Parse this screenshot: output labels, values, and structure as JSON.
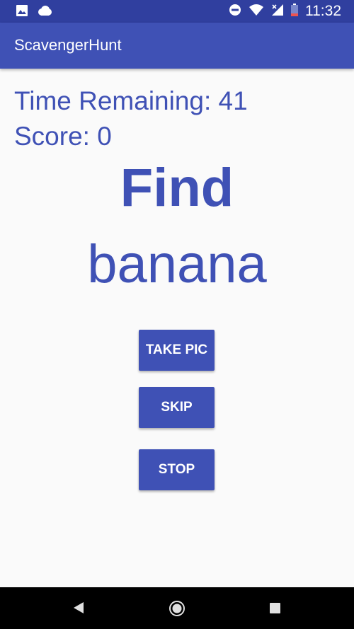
{
  "status_bar": {
    "time": "11:32",
    "left_icons": [
      "image-icon",
      "cloud-icon"
    ],
    "right_icons": [
      "do-not-disturb-icon",
      "wifi-icon",
      "cellular-no-data-icon",
      "battery-low-icon"
    ]
  },
  "app_bar": {
    "title": "ScavengerHunt"
  },
  "game": {
    "time_remaining": "Time Remaining: 41",
    "score": "Score: 0",
    "instruction": "Find",
    "target": "banana"
  },
  "actions": {
    "take_pic_label": "TAKE PIC",
    "skip_label": "SKIP",
    "stop_label": "STOP"
  },
  "nav_bar": {
    "icons": [
      "back-icon",
      "home-icon",
      "recents-icon"
    ]
  },
  "colors": {
    "primary": "#3f51b5",
    "primary_dark": "#303f9f",
    "background": "#fafafa"
  }
}
